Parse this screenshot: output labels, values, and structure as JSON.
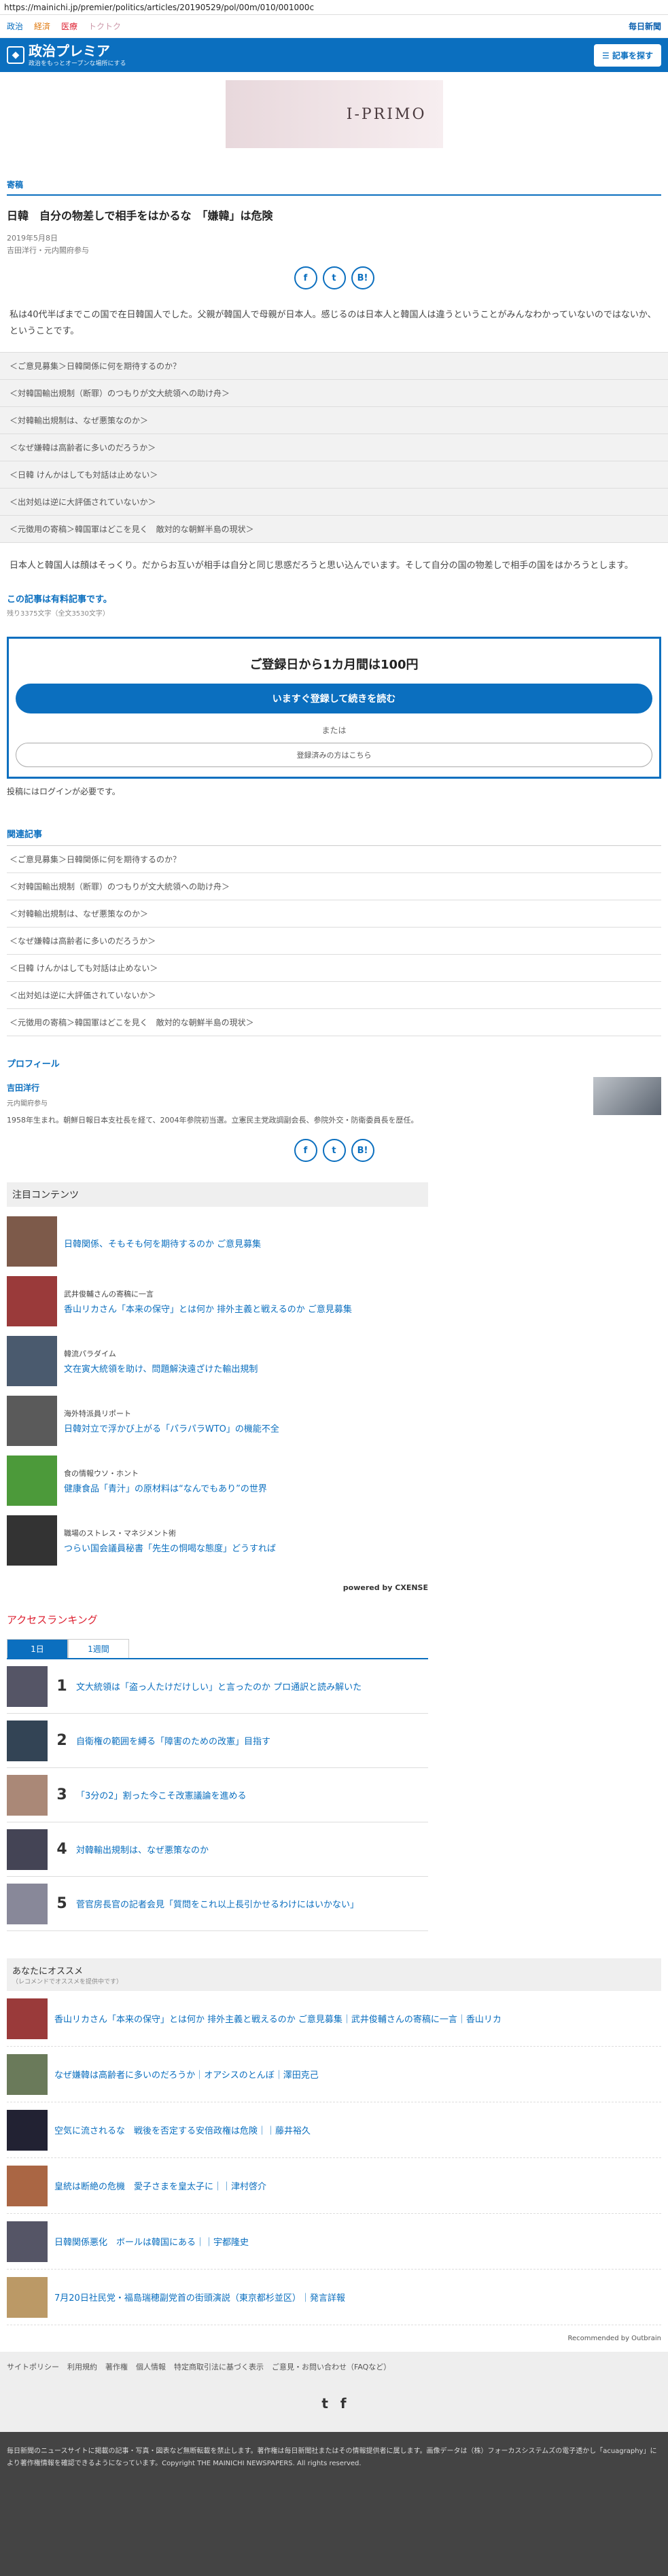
{
  "url": "https://mainichi.jp/premier/politics/articles/20190529/pol/00m/010/001000c",
  "topnav": {
    "links": [
      "政治",
      "経済",
      "医療",
      "トクトク"
    ],
    "brand": "毎日新聞"
  },
  "header": {
    "title": "政治プレミア",
    "subtitle": "政治をもっとオープンな場所にする",
    "search": "記事を探す"
  },
  "ad": {
    "text": "I-PRIMO"
  },
  "article": {
    "category": "寄稿",
    "title": "日韓　自分の物差しで相手をはかるな　「嫌韓」は危険",
    "date": "2019年5月8日",
    "author": "吉田洋行・元内閣府参与",
    "share": [
      "f",
      "t",
      "B!"
    ],
    "lead": "私は40代半ばまでこの国で在日韓国人でした。父親が韓国人で母親が日本人。感じるのは日本人と韓国人は違うということがみんなわかっていないのではないか、ということです。",
    "toc": [
      "＜ご意見募集＞日韓関係に何を期待するのか？",
      "＜対韓国輸出規制（断罪）のつもりが文大統領への助け舟＞",
      "＜対韓輸出規制は、なぜ悪策なのか＞",
      "＜なぜ嫌韓は高齢者に多いのだろうか＞",
      "＜日韓 けんかはしても対話は止めない＞",
      "＜出対処は逆に大評価されていないか＞",
      "＜元徴用の寄稿＞韓国軍はどこを見く　敵対的な朝鮮半島の現状＞"
    ],
    "body": "日本人と韓国人は顔はそっくり。だからお互いが相手は自分と同じ思惑だろうと思い込んでいます。そして自分の国の物差しで相手の国をはかろうとします。",
    "paid": {
      "title": "この記事は有料記事です。",
      "remain": "残り3375文字（全文3530文字）"
    },
    "register": {
      "title": "ご登録日から1カ月間は100円",
      "button": "いますぐ登録して続きを読む",
      "or": "または",
      "login": "登録済みの方はこちら"
    },
    "post_note": "投稿にはログインが必要です。"
  },
  "related": {
    "heading": "関連記事",
    "items": [
      "＜ご意見募集＞日韓関係に何を期待するのか？",
      "＜対韓国輸出規制（断罪）のつもりが文大統領への助け舟＞",
      "＜対韓輸出規制は、なぜ悪策なのか＞",
      "＜なぜ嫌韓は高齢者に多いのだろうか＞",
      "＜日韓 けんかはしても対話は止めない＞",
      "＜出対処は逆に大評価されていないか＞",
      "＜元徴用の寄稿＞韓国軍はどこを見く　敵対的な朝鮮半島の現状＞"
    ]
  },
  "profile": {
    "heading": "プロフィール",
    "name": "吉田洋行",
    "role": "元内閣府参与",
    "bio": "1958年生まれ。朝鮮日報日本支社長を経て、2004年参院初当選。立憲民主党政調副会長、参院外交・防衛委員長を歴任。"
  },
  "chui": {
    "heading": "注目コンテンツ",
    "items": [
      {
        "label": "",
        "link": "日韓関係、そもそも何を期待するのか ご意見募集"
      },
      {
        "label": "武井俊輔さんの寄稿に一言",
        "link": "香山リカさん「本来の保守」とは何か 排外主義と戦えるのか ご意見募集"
      },
      {
        "label": "韓流パラダイム",
        "link": "文在寅大統領を助け、問題解決遠ざけた輸出規制"
      },
      {
        "label": "海外特派員リポート",
        "link": "日韓対立で浮かび上がる「パラパラWTO」の機能不全"
      },
      {
        "label": "食の情報ウソ・ホント",
        "link": "健康食品「青汁」の原材料は“なんでもあり”の世界"
      },
      {
        "label": "職場のストレス・マネジメント術",
        "link": "つらい国会議員秘書「先生の恫喝な態度」どうすれば"
      }
    ],
    "powered": "powered by CXENSE"
  },
  "ranking": {
    "heading": "アクセスランキング",
    "tabs": [
      "1日",
      "1週間"
    ],
    "items": [
      {
        "num": "1",
        "text": "文大統領は「盗っ人たけだけしい」と言ったのか プロ通訳と読み解いた"
      },
      {
        "num": "2",
        "text": "自衛権の範囲を縛る「障害のための改憲」目指す"
      },
      {
        "num": "3",
        "text": "「3分の2」割った今こそ改憲議論を進める"
      },
      {
        "num": "4",
        "text": "対韓輸出規制は、なぜ悪策なのか"
      },
      {
        "num": "5",
        "text": "菅官房長官の記者会見「質問をこれ以上長引かせるわけにはいかない」"
      }
    ]
  },
  "reco": {
    "heading": "あなたにオススメ",
    "sub": "（レコメンドでオススメを提供中です）",
    "items": [
      "香山リカさん「本来の保守」とは何か 排外主義と戦えるのか ご意見募集｜武井俊輔さんの寄稿に一言｜香山リカ",
      "なぜ嫌韓は高齢者に多いのだろうか｜オアシスのとんぼ｜澤田克己",
      "空気に流されるな　戦後を否定する安倍政権は危険｜｜藤井裕久",
      "皇統は断絶の危機　愛子さまを皇太子に｜｜津村啓介",
      "日韓関係悪化　ボールは韓国にある｜｜宇都隆史",
      "7月20日社民党・福島瑞穂副党首の街頭演説（東京都杉並区）｜発言詳報"
    ],
    "by": "Recommended by Outbrain"
  },
  "footer": {
    "links": [
      "サイトポリシー",
      "利用規約",
      "著作権",
      "個人情報",
      "特定商取引法に基づく表示",
      "ご意見・お問い合わせ（FAQなど）"
    ],
    "social": [
      "t",
      "f"
    ],
    "copy": "毎日新聞のニュースサイトに掲載の記事・写真・図表など無断転載を禁止します。著作権は毎日新聞社またはその情報提供者に属します。画像データは（株）フォーカスシステムズの電子透かし「acuagraphy」により著作権情報を確認できるようになっています。Copyright THE MAINICHI NEWSPAPERS. All rights reserved."
  }
}
